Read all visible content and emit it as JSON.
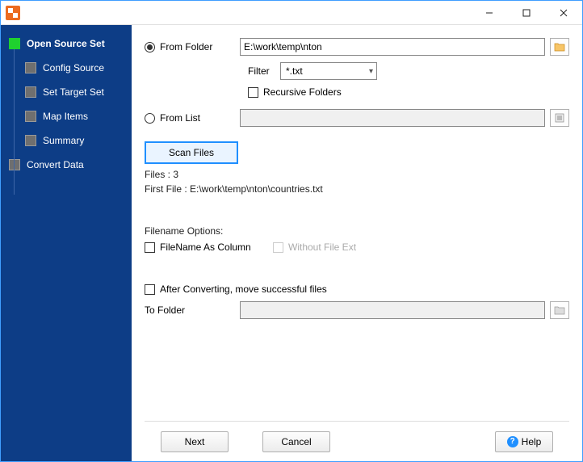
{
  "sidebar": {
    "items": [
      {
        "label": "Open Source Set"
      },
      {
        "label": "Config Source"
      },
      {
        "label": "Set Target Set"
      },
      {
        "label": "Map Items"
      },
      {
        "label": "Summary"
      },
      {
        "label": "Convert Data"
      }
    ]
  },
  "source": {
    "from_folder_label": "From Folder",
    "folder_path": "E:\\work\\temp\\nton",
    "filter_label": "Filter",
    "filter_value": "*.txt",
    "recursive_label": "Recursive Folders",
    "from_list_label": "From List",
    "from_list_value": ""
  },
  "scan": {
    "button": "Scan Files",
    "files_label": "Files : 3",
    "first_file_label": "First File : E:\\work\\temp\\nton\\countries.txt"
  },
  "filename_opts": {
    "heading": "Filename Options:",
    "as_column": "FileName As Column",
    "without_ext": "Without File Ext"
  },
  "after": {
    "move_label": "After Converting, move successful files",
    "to_folder_label": "To Folder",
    "to_folder_value": ""
  },
  "footer": {
    "next": "Next",
    "cancel": "Cancel",
    "help": "Help"
  }
}
